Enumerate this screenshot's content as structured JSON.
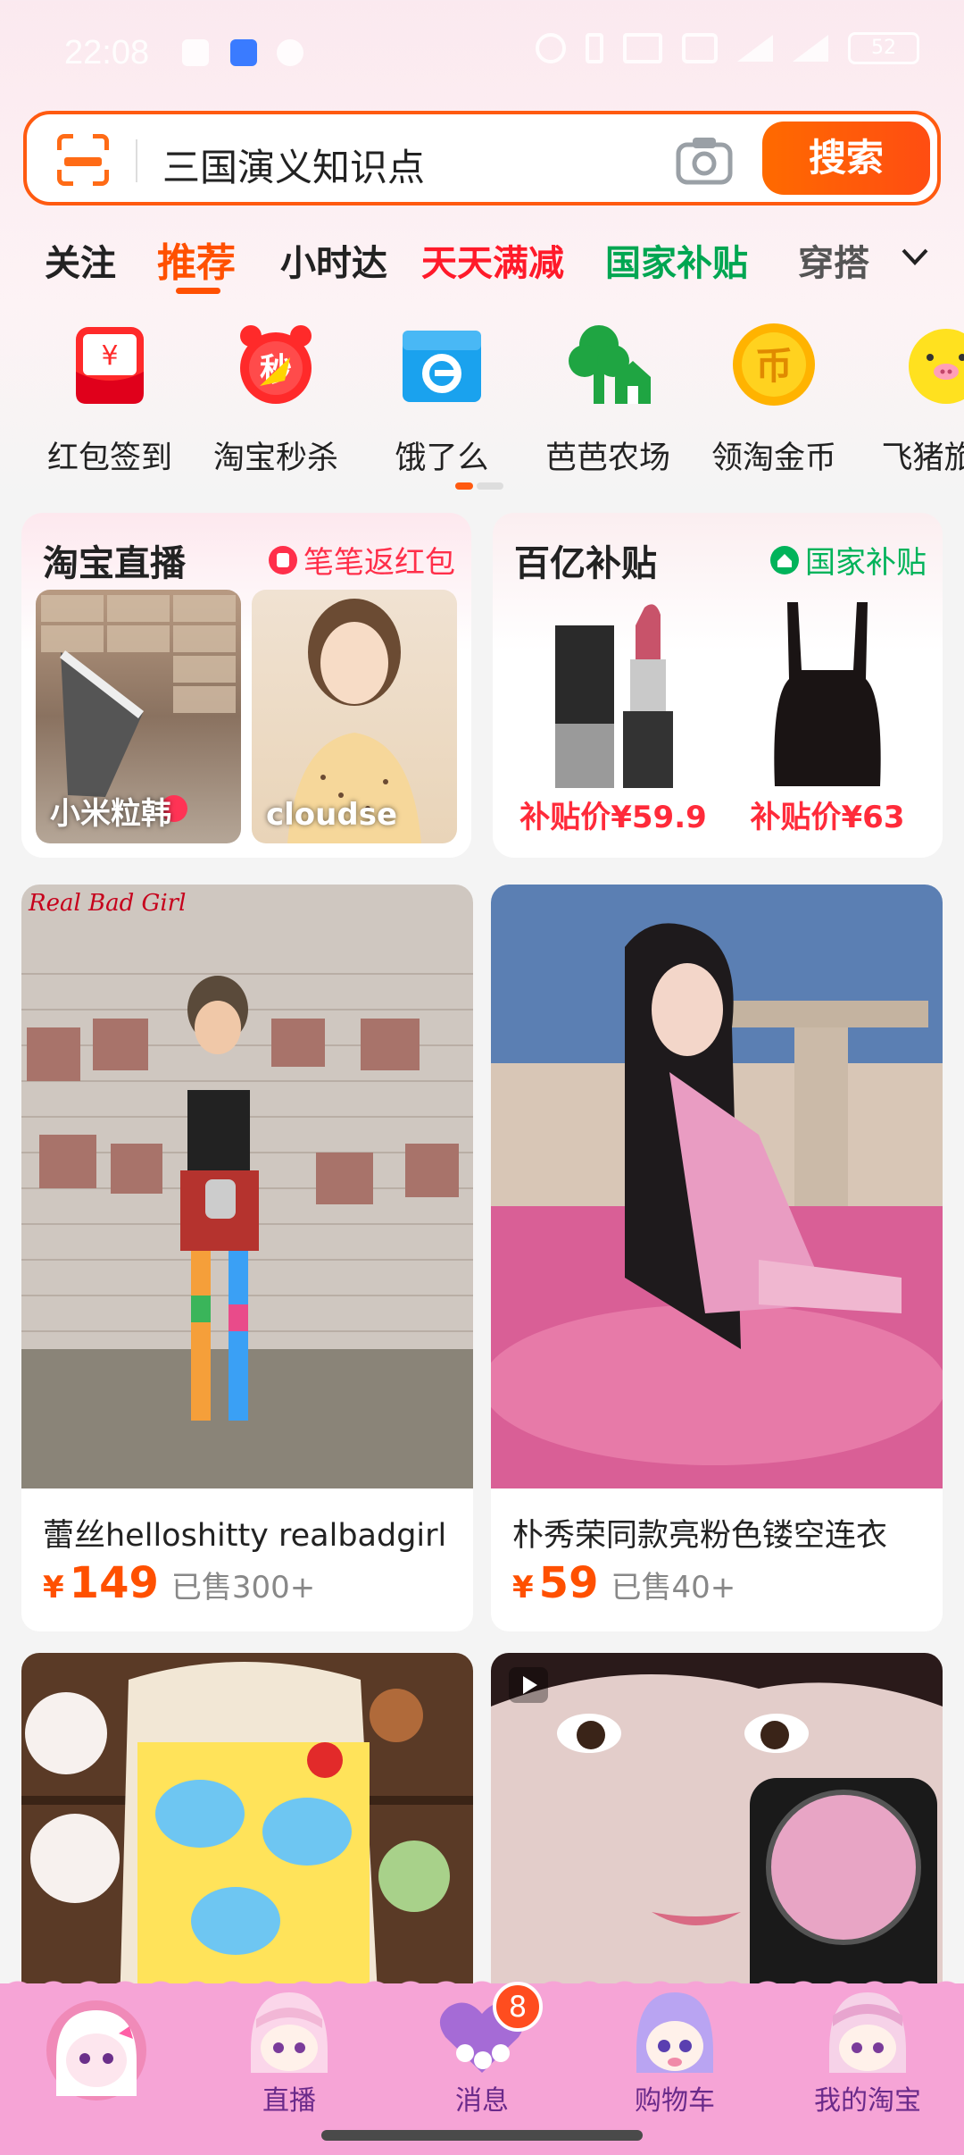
{
  "status_bar": {
    "time": "22:08",
    "battery": "52"
  },
  "search": {
    "query": "三国演义知识点",
    "button_label": "搜索"
  },
  "tabs": [
    {
      "label": "关注",
      "color": "#222222"
    },
    {
      "label": "推荐",
      "color": "#ff5000",
      "active": true
    },
    {
      "label": "小时达",
      "color": "#222222"
    },
    {
      "label": "天天满减",
      "color": "#ff1a2a"
    },
    {
      "label": "国家补贴",
      "color": "#00a651"
    },
    {
      "label": "穿搭",
      "color": "#222222"
    }
  ],
  "shortcuts": [
    {
      "label": "红包签到",
      "icon": "red-envelope-icon"
    },
    {
      "label": "淘宝秒杀",
      "icon": "alarm-clock-icon"
    },
    {
      "label": "饿了么",
      "icon": "eleme-box-icon"
    },
    {
      "label": "芭芭农场",
      "icon": "tree-farm-icon"
    },
    {
      "label": "领淘金币",
      "icon": "gold-coin-icon"
    },
    {
      "label": "飞猪旅",
      "icon": "fliggy-pig-icon"
    }
  ],
  "promo": {
    "live": {
      "title": "淘宝直播",
      "tag": "笔笔返红包",
      "items": [
        {
          "name": "小米粒韩"
        },
        {
          "name": "cloudse"
        }
      ]
    },
    "subsidy": {
      "title": "百亿补贴",
      "tag": "国家补贴",
      "items": [
        {
          "price": "补贴价¥59.9"
        },
        {
          "price": "补贴价¥63"
        }
      ]
    }
  },
  "feed": [
    {
      "brand_text": "Real Bad Girl",
      "title": "蕾丝helloshitty realbadgirl",
      "currency": "¥",
      "price": "149",
      "sold": "已售300+"
    },
    {
      "title": "朴秀荣同款亮粉色镂空连衣",
      "currency": "¥",
      "price": "59",
      "sold": "已售40+"
    },
    {
      "title": ""
    },
    {
      "title": ""
    }
  ],
  "bottom_nav": [
    {
      "label": ""
    },
    {
      "label": "直播"
    },
    {
      "label": "消息",
      "badge": "8"
    },
    {
      "label": "购物车"
    },
    {
      "label": "我的淘宝"
    }
  ]
}
